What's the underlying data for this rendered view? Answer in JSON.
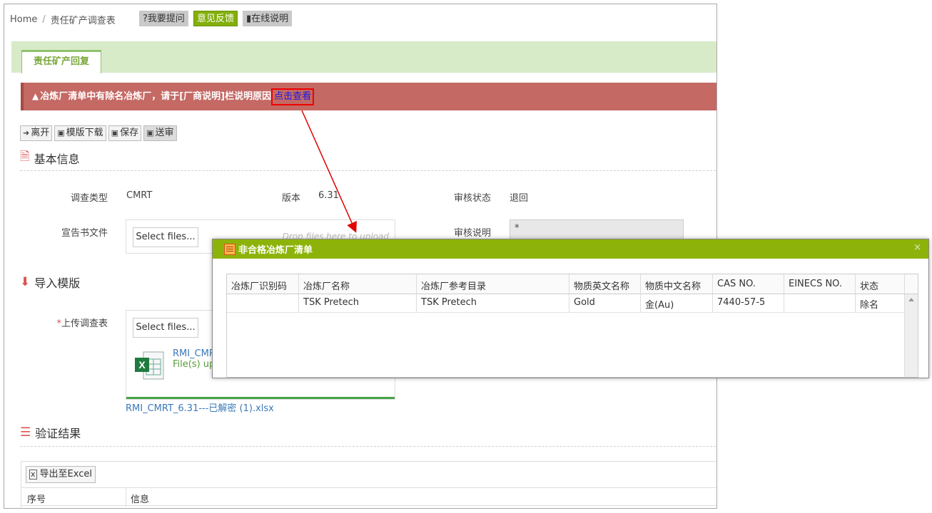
{
  "breadcrumb": {
    "home": "Home",
    "sep": "/",
    "current": "责任矿产调查表"
  },
  "top_buttons": {
    "ask": "?我要提问",
    "feedback": "意见反馈",
    "help": "在线说明"
  },
  "tab": {
    "label": "责任矿产回复"
  },
  "alert": {
    "message": "冶炼厂清单中有除名冶炼厂，请于[厂商说明]栏说明原因",
    "link": "点击查看"
  },
  "toolbar": {
    "leave": "离开",
    "download_template": "模版下载",
    "save": "保存",
    "submit": "送审"
  },
  "basic_info": {
    "title": "基本信息",
    "survey_type_label": "调查类型",
    "survey_type_value": "CMRT",
    "version_label": "版本",
    "version_value": "6.31",
    "review_status_label": "审核状态",
    "review_status_value": "退回",
    "declaration_label": "宣告书文件",
    "select_files": "Select files...",
    "drop_hint": "Drop files here to upload",
    "review_note_label": "审核说明",
    "review_note_value": "*"
  },
  "import": {
    "title": "导入模版",
    "upload_label": "上传调查表",
    "required_mark": "*",
    "select_files": "Select files...",
    "file_name": "RMI_CMRT",
    "file_status": "File(s) up",
    "file_link": "RMI_CMRT_6.31---已解密 (1).xlsx"
  },
  "validation": {
    "title": "验证结果",
    "export": "导出至Excel",
    "col_index": "序号",
    "col_info": "信息"
  },
  "modal": {
    "title": "非合格冶炼厂清单",
    "close": "×",
    "columns": [
      "冶炼厂识别码",
      "冶炼厂名称",
      "冶炼厂参考目录",
      "物质英文名称",
      "物质中文名称",
      "CAS NO.",
      "EINECS NO.",
      "状态"
    ],
    "rows": [
      [
        "",
        "TSK Pretech",
        "TSK Pretech",
        "Gold",
        "金(Au)",
        "7440-57-5",
        "",
        "除名"
      ]
    ]
  },
  "colors": {
    "accent_green": "#8db30a",
    "alert_red": "#c46964",
    "tab_bg": "#d8ebc8",
    "link_blue": "#3a79b8"
  }
}
